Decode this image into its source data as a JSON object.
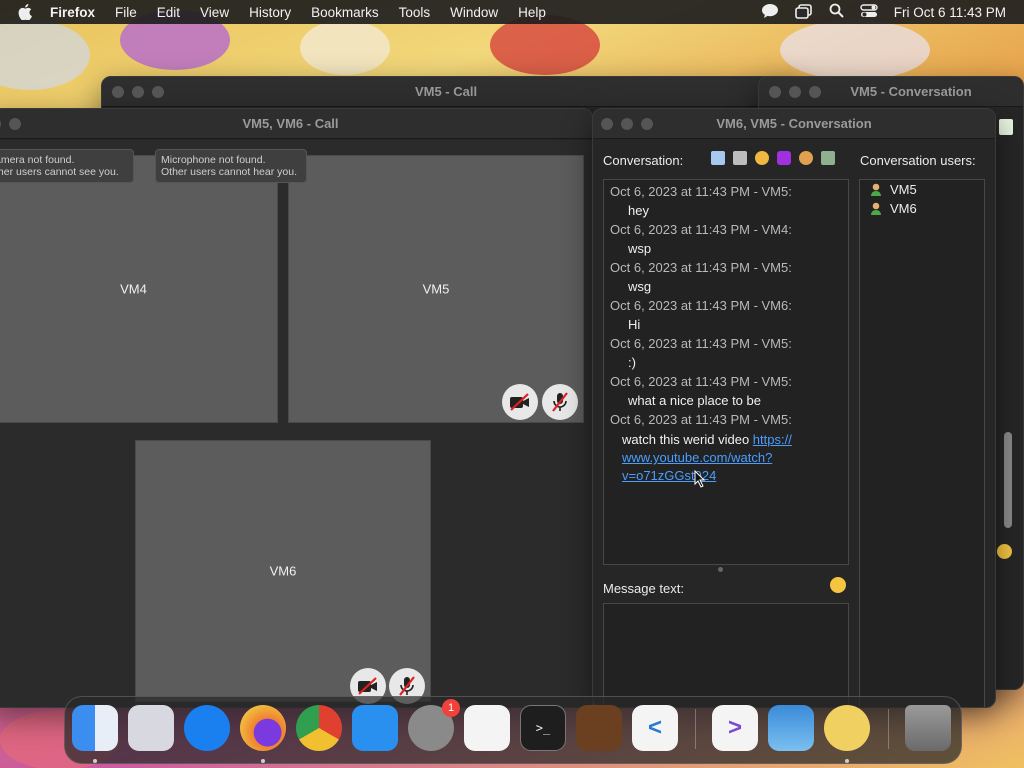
{
  "menubar": {
    "app": "Firefox",
    "items": [
      "File",
      "Edit",
      "View",
      "History",
      "Bookmarks",
      "Tools",
      "Window",
      "Help"
    ],
    "clock": "Fri Oct 6  11:43 PM"
  },
  "back_call_window": {
    "title": "VM5 - Call"
  },
  "back_conv_window": {
    "title": "VM5 - Conversation"
  },
  "call_window": {
    "title": "VM5, VM6 - Call",
    "camera_tip": [
      "amera not found.",
      "ther users cannot see you."
    ],
    "mic_tip": [
      "Microphone not found.",
      "Other users cannot hear you."
    ],
    "tiles": [
      "VM4",
      "VM5",
      "VM6"
    ]
  },
  "conv_window": {
    "title": "VM6, VM5 - Conversation",
    "conversation_label": "Conversation:",
    "users_label": "Conversation users:",
    "message_label": "Message text:",
    "toolbar_icons": [
      "notes-icon",
      "copy-icon",
      "gear-icon",
      "video-call-icon",
      "add-user-icon",
      "document-icon"
    ],
    "messages": [
      {
        "meta": "Oct 6, 2023 at 11:43 PM - VM5:",
        "text": "hey"
      },
      {
        "meta": "Oct 6, 2023 at 11:43 PM - VM4:",
        "text": "wsp"
      },
      {
        "meta": "Oct 6, 2023 at 11:43 PM - VM5:",
        "text": "wsg"
      },
      {
        "meta": "Oct 6, 2023 at 11:43 PM - VM6:",
        "text": "Hi"
      },
      {
        "meta": "Oct 6, 2023 at 11:43 PM - VM5:",
        "text": ":)"
      },
      {
        "meta": "Oct 6, 2023 at 11:43 PM - VM5:",
        "text": "what a nice place to be"
      },
      {
        "meta": "Oct 6, 2023 at 11:43 PM - VM5:",
        "text": "watch this werid video ",
        "link": [
          "https://",
          "www.youtube.com/watch?",
          "v=o71zGGst924"
        ]
      }
    ],
    "users": [
      "VM5",
      "VM6"
    ]
  },
  "dock": {
    "apps": [
      "Finder",
      "Launchpad",
      "Safari",
      "Firefox",
      "Chrome",
      "App Store",
      "System Settings",
      "TextEdit",
      "Terminal",
      "GarageBand",
      "VS Code",
      "Visual Studio",
      "Weather",
      "Chat",
      "Trash"
    ],
    "settings_badge": "1"
  }
}
